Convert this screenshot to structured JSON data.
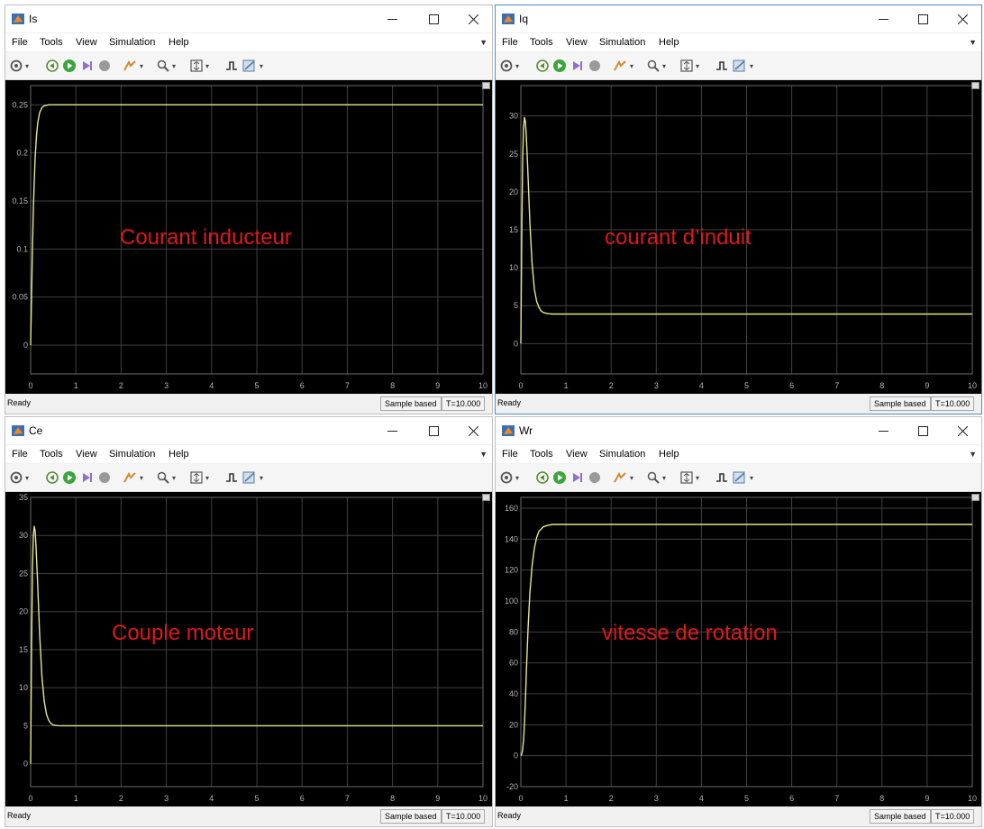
{
  "menu": [
    "File",
    "Tools",
    "View",
    "Simulation",
    "Help"
  ],
  "status": {
    "ready": "Ready",
    "sample": "Sample based",
    "time": "T=10.000"
  },
  "icons": {
    "window": "matlab-scope-icon",
    "minimize": "minimize-icon",
    "maximize": "maximize-icon",
    "close": "close-icon",
    "toolbar": [
      "settings-icon",
      "stepback-icon",
      "run-icon",
      "step-forward-icon",
      "stop-icon",
      "highlight-icon",
      "zoom-icon",
      "scale-axes-icon",
      "triggers-icon",
      "style-icon"
    ]
  },
  "colors": {
    "plot_bg": "#000000",
    "grid": "#404040",
    "trace": "#e6e68a",
    "ticks": "#b3b3b3",
    "label": "#e01818"
  },
  "windows": [
    {
      "title": "Is",
      "label": "Courant inducteur",
      "chart_data": {
        "type": "line",
        "xlim": [
          0,
          10
        ],
        "ylim": [
          -0.03,
          0.27
        ],
        "x_ticks": [
          "0",
          "1",
          "2",
          "3",
          "4",
          "5",
          "6",
          "7",
          "8",
          "9",
          "10"
        ],
        "y_ticks": [
          {
            "v": 0,
            "t": "0"
          },
          {
            "v": 0.05,
            "t": "0.05"
          },
          {
            "v": 0.1,
            "t": "0.1"
          },
          {
            "v": 0.15,
            "t": "0.15"
          },
          {
            "v": 0.2,
            "t": "0.2"
          },
          {
            "v": 0.25,
            "t": "0.25"
          }
        ],
        "series": [
          {
            "x": [
              0,
              0.02,
              0.04,
              0.06,
              0.08,
              0.1,
              0.13,
              0.16,
              0.2,
              0.25,
              0.3,
              0.4,
              0.5,
              1,
              3,
              6,
              10
            ],
            "y": [
              0,
              0.05,
              0.1,
              0.14,
              0.17,
              0.195,
              0.218,
              0.232,
              0.242,
              0.247,
              0.249,
              0.25,
              0.25,
              0.25,
              0.25,
              0.25,
              0.25
            ]
          }
        ]
      }
    },
    {
      "title": "Iq",
      "label": "courant d’induit",
      "chart_data": {
        "type": "line",
        "xlim": [
          0,
          10
        ],
        "ylim": [
          -4,
          34
        ],
        "x_ticks": [
          "0",
          "1",
          "2",
          "3",
          "4",
          "5",
          "6",
          "7",
          "8",
          "9",
          "10"
        ],
        "y_ticks": [
          {
            "v": 0,
            "t": "0"
          },
          {
            "v": 5,
            "t": "5"
          },
          {
            "v": 10,
            "t": "10"
          },
          {
            "v": 15,
            "t": "15"
          },
          {
            "v": 20,
            "t": "20"
          },
          {
            "v": 25,
            "t": "25"
          },
          {
            "v": 30,
            "t": "30"
          }
        ],
        "series": [
          {
            "x": [
              0,
              0.02,
              0.04,
              0.06,
              0.08,
              0.1,
              0.12,
              0.15,
              0.2,
              0.25,
              0.3,
              0.35,
              0.4,
              0.45,
              0.5,
              0.6,
              0.7,
              0.8,
              1,
              2,
              5,
              10
            ],
            "y": [
              0,
              14,
              24,
              28.5,
              29.8,
              29.3,
              27.5,
              23.5,
              16,
              10.5,
              7.2,
              5.6,
              4.8,
              4.3,
              4.1,
              3.95,
              3.9,
              3.9,
              3.9,
              3.9,
              3.9,
              3.9
            ]
          }
        ]
      }
    },
    {
      "title": "Ce",
      "label": "Couple moteur",
      "chart_data": {
        "type": "line",
        "xlim": [
          0,
          10
        ],
        "ylim": [
          -3,
          35
        ],
        "x_ticks": [
          "0",
          "1",
          "2",
          "3",
          "4",
          "5",
          "6",
          "7",
          "8",
          "9",
          "10"
        ],
        "y_ticks": [
          {
            "v": 0,
            "t": "0"
          },
          {
            "v": 5,
            "t": "5"
          },
          {
            "v": 10,
            "t": "10"
          },
          {
            "v": 15,
            "t": "15"
          },
          {
            "v": 20,
            "t": "20"
          },
          {
            "v": 25,
            "t": "25"
          },
          {
            "v": 30,
            "t": "30"
          },
          {
            "v": 35,
            "t": "35"
          }
        ],
        "series": [
          {
            "x": [
              0,
              0.02,
              0.04,
              0.06,
              0.08,
              0.1,
              0.12,
              0.15,
              0.2,
              0.25,
              0.3,
              0.35,
              0.4,
              0.45,
              0.5,
              0.6,
              0.7,
              0.8,
              1,
              2,
              5,
              10
            ],
            "y": [
              0,
              15,
              25.5,
              30,
              31.2,
              30.6,
              28.5,
              24.5,
              17,
              11.5,
              8.2,
              6.5,
              5.7,
              5.3,
              5.1,
              5.02,
              5,
              5,
              5,
              5,
              5,
              5
            ]
          }
        ]
      }
    },
    {
      "title": "Wr",
      "label": "vitesse de rotation",
      "chart_data": {
        "type": "line",
        "xlim": [
          0,
          10
        ],
        "ylim": [
          -20,
          167
        ],
        "x_ticks": [
          "0",
          "1",
          "2",
          "3",
          "4",
          "5",
          "6",
          "7",
          "8",
          "9",
          "10"
        ],
        "y_ticks": [
          {
            "v": -20,
            "t": "-20"
          },
          {
            "v": 0,
            "t": "0"
          },
          {
            "v": 20,
            "t": "20"
          },
          {
            "v": 40,
            "t": "40"
          },
          {
            "v": 60,
            "t": "60"
          },
          {
            "v": 80,
            "t": "80"
          },
          {
            "v": 100,
            "t": "100"
          },
          {
            "v": 120,
            "t": "120"
          },
          {
            "v": 140,
            "t": "140"
          },
          {
            "v": 160,
            "t": "160"
          }
        ],
        "series": [
          {
            "x": [
              0,
              0.02,
              0.04,
              0.06,
              0.08,
              0.1,
              0.13,
              0.16,
              0.2,
              0.25,
              0.3,
              0.35,
              0.4,
              0.5,
              0.6,
              0.7,
              0.8,
              1,
              2,
              5,
              10
            ],
            "y": [
              0,
              1,
              4,
              10,
              20,
              35,
              60,
              82,
              105,
              123,
              134,
              141,
              145,
              148,
              149,
              149.5,
              149.5,
              149.5,
              149.5,
              149.5,
              149.5
            ]
          }
        ]
      }
    }
  ]
}
